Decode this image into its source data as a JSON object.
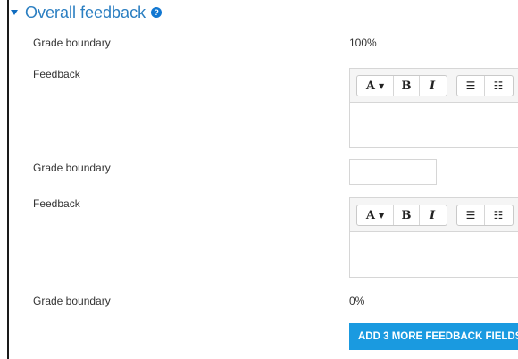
{
  "section": {
    "title": "Overall feedback",
    "help_icon": "question-circle-icon"
  },
  "rows": {
    "grade_boundary_1_label": "Grade boundary",
    "grade_boundary_1_value": "100%",
    "feedback_1_label": "Feedback",
    "grade_boundary_2_label": "Grade boundary",
    "grade_boundary_2_value": "",
    "feedback_2_label": "Feedback",
    "grade_boundary_3_label": "Grade boundary",
    "grade_boundary_3_value": "0%"
  },
  "toolbar": {
    "font_glyph": "A",
    "bold_glyph": "B",
    "italic_glyph": "I"
  },
  "buttons": {
    "add_more_label": "ADD 3 MORE FEEDBACK FIELDS"
  }
}
